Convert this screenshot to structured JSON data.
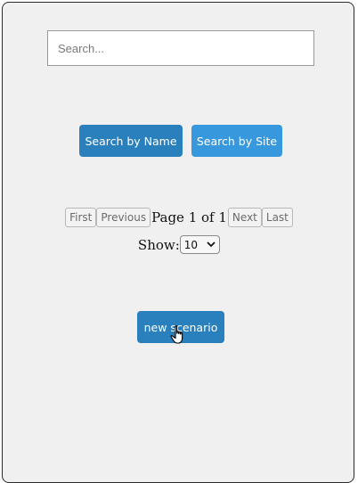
{
  "search": {
    "value": "",
    "placeholder": "Search..."
  },
  "buttons": {
    "search_by_name": "Search by Name",
    "search_by_site": "Search by Site",
    "new_scenario": "new scenario"
  },
  "pagination": {
    "first": "First",
    "previous": "Previous",
    "page_info": "Page 1 of 1",
    "next": "Next",
    "last": "Last"
  },
  "show": {
    "label": "Show:",
    "selected": "10"
  },
  "icons": {
    "select_arrow": "chevron-down-icon",
    "cursor": "hand-pointer-icon"
  },
  "colors": {
    "primary_button": "#2a7fbd",
    "secondary_button": "#3798dd",
    "panel_background": "#f0f0f0"
  }
}
